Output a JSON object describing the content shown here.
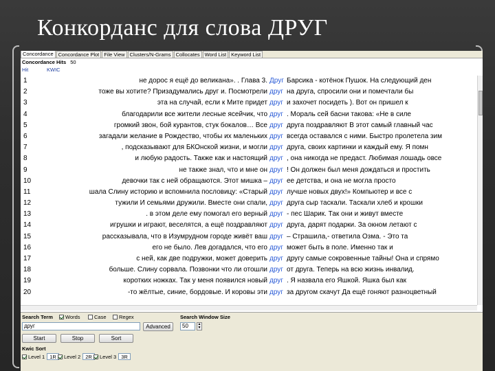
{
  "slide": {
    "title": "Конкорданс для слова ДРУГ"
  },
  "tabs": [
    {
      "label": "Concordance",
      "active": true
    },
    {
      "label": "Concordance Plot",
      "active": false
    },
    {
      "label": "File View",
      "active": false
    },
    {
      "label": "Clusters/N-Grams",
      "active": false
    },
    {
      "label": "Collocates",
      "active": false
    },
    {
      "label": "Word List",
      "active": false
    },
    {
      "label": "Keyword List",
      "active": false
    }
  ],
  "results": {
    "hits_label": "Concordance Hits",
    "hits_count": "50",
    "col_hit": "Hit",
    "col_kwic": "KWIC",
    "keyword": "друг",
    "rows": [
      {
        "n": "1",
        "left": "не дорос я ещё до великана». . Глава 3.",
        "kw": "Друг",
        "right": "Барсика - котёнок Пушок.   На следующий ден"
      },
      {
        "n": "2",
        "left": "тоже вы хотите?  Призадумались друг и. Посмотрели",
        "kw": "друг",
        "right": "на друга, спросили они и помечтали бы"
      },
      {
        "n": "3",
        "left": "эта на случай, если к Мите придет",
        "kw": "друг",
        "right": "и захочет посидеть ).  Вот он пришел  к"
      },
      {
        "n": "4",
        "left": "благодарили все жители лесные ясейчик, что",
        "kw": "друг",
        "right": ". Мораль сей басни такова: «Не в силе"
      },
      {
        "n": "5",
        "left": "громкий звон, бой курантов, стук бокалов… Все",
        "kw": "друг",
        "right": "друга поздравляют В этот самый главный час"
      },
      {
        "n": "6",
        "left": "загадали желание в Рождество, чтобы их маленьких",
        "kw": "друг",
        "right": "всегда оставался с ними. Быстро пролетела зим"
      },
      {
        "n": "7",
        "left": ", подсказывают для БКОнской жизни, и могли",
        "kw": "друг",
        "right": "друга, своих картинки и каждый ему. Я помн"
      },
      {
        "n": "8",
        "left": "и любую радость. Также как и настоящий",
        "kw": "друг",
        "right": ", она никогда не предаст. Любимая лошадь овсе"
      },
      {
        "n": "9",
        "left": "не также знал, что и мне он",
        "kw": "друг",
        "right": "! Он должен был меня дождаться и простить"
      },
      {
        "n": "10",
        "left": "девочки так с ней обращаются. Этот мишка –",
        "kw": "друг",
        "right": "ее детства, и она не могла просто"
      },
      {
        "n": "11",
        "left": "шала Слину историю и вспомнила пословицу: «Старый",
        "kw": "друг",
        "right": "лучше новых двух!»   Компьютер и все с"
      },
      {
        "n": "12",
        "left": "тужили И семьями дружили. Вместе они спали,",
        "kw": "друг",
        "right": "друга сыр таскали. Таскали хлеб и крошки"
      },
      {
        "n": "13",
        "left": ". в этом деле ему помогал его верный",
        "kw": "друг",
        "right": "- пес Шарик. Так они и живут вместе"
      },
      {
        "n": "14",
        "left": "игрушки и играют, веселятся, а ещё поздравляют",
        "kw": "друг",
        "right": "друга, дарят подарки. За окном летают с"
      },
      {
        "n": "15",
        "left": "рассказывала, что в Изумрудном городе живёт ваш",
        "kw": "друг",
        "right": "– Страшила,- ответила Озма.        - Это та"
      },
      {
        "n": "16",
        "left": "его не было. Лев догадался, что его",
        "kw": "друг",
        "right": "может быть в поле. Именно так и"
      },
      {
        "n": "17",
        "left": "с ней, как две подружки, может доверить",
        "kw": "друг",
        "right": "другу самые сокровенные тайны! Она и спрямо"
      },
      {
        "n": "18",
        "left": "больше. Слину сорвала. Позвонки что ли отошли",
        "kw": "друг",
        "right": "от друга. Теперь на всю жизнь инвалид."
      },
      {
        "n": "19",
        "left": "коротких ножках. Так у меня появился новый",
        "kw": "друг",
        "right": ". Я назвала его Яшкой. Яшка был как"
      },
      {
        "n": "20",
        "left": "-то жёлтые, синие, бордовые. И коровы эти",
        "kw": "друг",
        "right": "за другом скачут Да ещё гоняют разноцветный"
      }
    ]
  },
  "search": {
    "term_label": "Search Term",
    "words_label": "Words",
    "case_label": "Case",
    "regex_label": "Regex",
    "term_value": "друг",
    "advanced_label": "Advanced",
    "window_label": "Search Window Size",
    "window_value": "50",
    "start_label": "Start",
    "stop_label": "Stop",
    "sort_label": "Sort",
    "words_checked": true,
    "case_checked": false,
    "regex_checked": false
  },
  "kwic_sort": {
    "label": "Kwic Sort",
    "levels": [
      {
        "label": "Level 1",
        "value": "1R",
        "checked": true
      },
      {
        "label": "Level 2",
        "value": "2R",
        "checked": true
      },
      {
        "label": "Level 3",
        "value": "3R",
        "checked": true
      }
    ]
  }
}
